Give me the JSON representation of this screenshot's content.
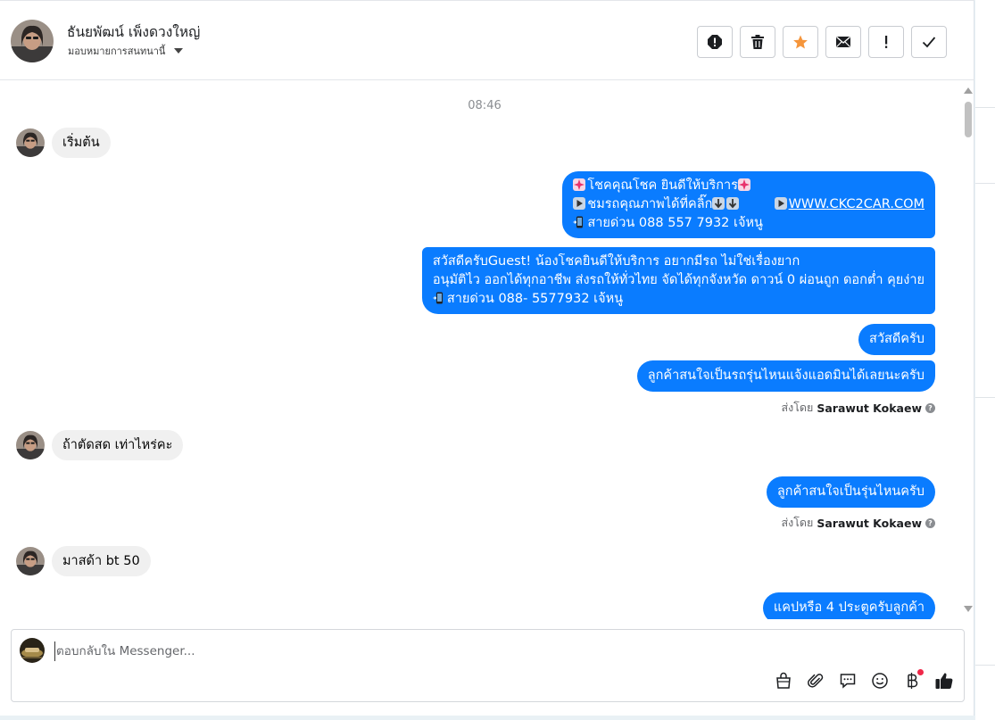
{
  "contact": {
    "name": "ธันยพัฒน์ เพ็งดวงใหญ่",
    "assignee": "มอบหมายการสนทนานี้"
  },
  "colors": {
    "accent": "#0a7cff",
    "star": "#f5953b",
    "incoming_bg": "#f0f0f0",
    "badge": "#f02849"
  },
  "header_actions": [
    {
      "name": "mark-spam-icon"
    },
    {
      "name": "trash-icon"
    },
    {
      "name": "star-icon"
    },
    {
      "name": "mail-icon"
    },
    {
      "name": "exclamation-icon"
    },
    {
      "name": "check-icon"
    }
  ],
  "messages": {
    "time_divider": "08:46",
    "in1": "เริ่มต้น",
    "out1": {
      "line1": "โชคคุณโชค ยินดีให้บริการ",
      "line2a": "ชมรถคุณภาพได้ที่คลิ๊ก",
      "line2_link": "WWW.CKC2CAR.COM",
      "line3": "สายด่วน 088 557 7932 เจ้หนู"
    },
    "out2": {
      "line1": "สวัสดีครับGuest! น้องโชคยินดีให้บริการ อยากมีรถ ไม่ใช่เรื่องยาก",
      "line2": "อนุมัติไว ออกได้ทุกอาชีพ ส่งรถให้ทั่วไทย จัดได้ทุกจังหวัด ดาวน์ 0  ผ่อนถูก ดอกต่ำ คุยง่าย",
      "line3": "สายด่วน 088- 5577932 เจ้หนู"
    },
    "out3": "สวัสดีครับ",
    "out4": "ลูกค้าสนใจเป็นรถรุ่นไหนแจ้งแอดมินได้เลยนะครับ",
    "sent_by_label": "ส่งโดย",
    "sent_by_name": "Sarawut Kokaew",
    "in2": "ถ้าตัดสด เท่าไหร่คะ",
    "out5": "ลูกค้าสนใจเป็นรุ่นไหนครับ",
    "in3": "มาสด้า bt 50",
    "out6": "แคปหรือ 4 ประตูครับลูกค้า"
  },
  "composer": {
    "placeholder": "ตอบกลับใน Messenger...",
    "tools": [
      "bag-icon",
      "paperclip-icon",
      "chat-bubble-icon",
      "smiley-icon",
      "baht-icon",
      "thumbs-up-icon"
    ]
  }
}
